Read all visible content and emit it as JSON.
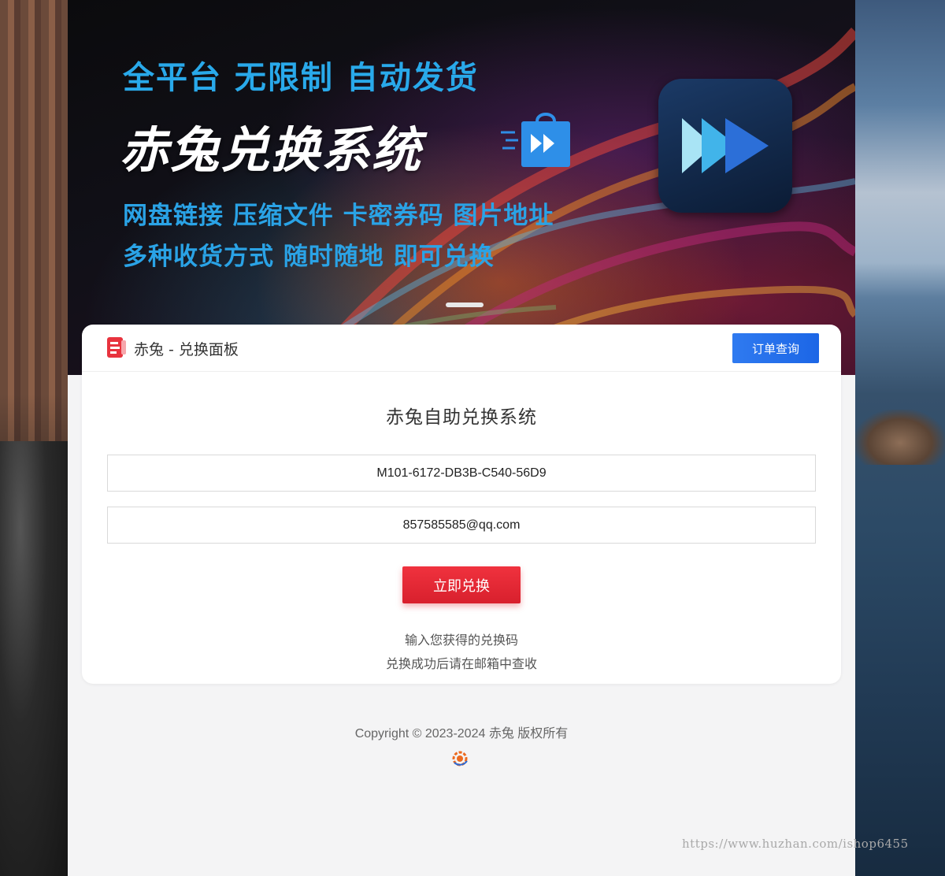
{
  "banner": {
    "line1": "全平台 无限制 自动发货",
    "line2": "赤兔兑换系统",
    "line3": "网盘链接 压缩文件 卡密券码 图片地址",
    "line4": "多种收货方式 随时随地 即可兑换",
    "icons": [
      "gift-play-icon",
      "fast-forward-icon"
    ]
  },
  "header": {
    "panel_title": "赤兔 - 兑换面板",
    "query_button": "订单查询",
    "icon": "document-icon"
  },
  "form": {
    "title": "赤兔自助兑换系统",
    "code_value": "M101-6172-DB3B-C540-56D9",
    "email_value": "857585585@qq.com",
    "submit_label": "立即兑换",
    "hint1": "输入您获得的兑换码",
    "hint2": "兑换成功后请在邮箱中查收"
  },
  "footer": {
    "copyright": "Copyright © 2023-2024 赤兔 版权所有",
    "logo_icon": "gear-logo-icon"
  },
  "watermark": "https://www.huzhan.com/ishop6455",
  "colors": {
    "accent_blue": "#1c66e6",
    "accent_red": "#e02632",
    "banner_text_blue": "#2aa3e6"
  }
}
